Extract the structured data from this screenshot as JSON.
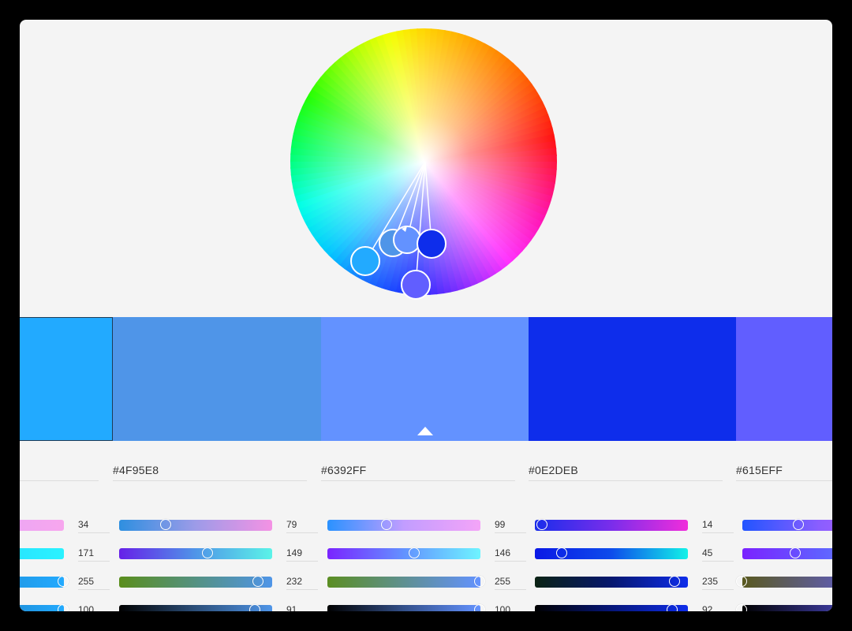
{
  "colors": {
    "panel_bg": "#f4f4f4",
    "swatch_border": "#1d3c57",
    "marker": "#ffffff"
  },
  "wheel": {
    "handles": [
      {
        "name": "handle-1",
        "color": "#22AAFF"
      },
      {
        "name": "handle-2",
        "color": "#4F95E8"
      },
      {
        "name": "handle-3",
        "color": "#6392FF"
      },
      {
        "name": "handle-4",
        "color": "#0E2DEB"
      },
      {
        "name": "handle-5",
        "color": "#615EFF"
      }
    ]
  },
  "swatches": [
    {
      "name": "swatch-1",
      "color": "#22AAFF",
      "selected": true,
      "marker": false
    },
    {
      "name": "swatch-2",
      "color": "#4F95E8",
      "selected": false,
      "marker": false
    },
    {
      "name": "swatch-3",
      "color": "#6392FF",
      "selected": false,
      "marker": true
    },
    {
      "name": "swatch-4",
      "color": "#0E2DEB",
      "selected": false,
      "marker": false
    },
    {
      "name": "swatch-5",
      "color": "#615EFF",
      "selected": false,
      "marker": false
    }
  ],
  "columns": [
    {
      "hex": "",
      "rows": [
        {
          "value": "34",
          "fraction": 0.12,
          "gradient": "linear-gradient(90deg,#d9a4ff,#f7a6ee)"
        },
        {
          "value": "171",
          "fraction": 0.67,
          "gradient": "linear-gradient(90deg,#24c9ff,#2af2ff)"
        },
        {
          "value": "255",
          "fraction": 1.0,
          "gradient": "linear-gradient(90deg,#1e7ab8,#22aaff)"
        },
        {
          "value": "100",
          "fraction": 1.0,
          "gradient": "linear-gradient(90deg,#1b5e93,#22aaff)"
        }
      ]
    },
    {
      "hex": "#4F95E8",
      "rows": [
        {
          "value": "79",
          "fraction": 0.31,
          "gradient": "linear-gradient(90deg,#2e8fe0,#9d9be8,#f492e4)"
        },
        {
          "value": "149",
          "fraction": 0.58,
          "gradient": "linear-gradient(90deg,#6620e8,#4f95e8,#5bf3e8)"
        },
        {
          "value": "232",
          "fraction": 0.91,
          "gradient": "linear-gradient(90deg,#5a8e1c,#4f95e8)"
        },
        {
          "value": "91",
          "fraction": 0.89,
          "gradient": "linear-gradient(90deg,#000000,#2c4f7a,#4f95e8)"
        }
      ]
    },
    {
      "hex": "#6392FF",
      "rows": [
        {
          "value": "99",
          "fraction": 0.39,
          "gradient": "linear-gradient(90deg,#2a92ff,#c29dff,#f4a4f8)"
        },
        {
          "value": "146",
          "fraction": 0.57,
          "gradient": "linear-gradient(90deg,#7a24ff,#6392ff,#6ef4ff)"
        },
        {
          "value": "255",
          "fraction": 1.0,
          "gradient": "linear-gradient(90deg,#5b8e22,#6392ff)"
        },
        {
          "value": "100",
          "fraction": 1.0,
          "gradient": "linear-gradient(90deg,#000000,#33508a,#6392ff)"
        }
      ]
    },
    {
      "hex": "#0E2DEB",
      "rows": [
        {
          "value": "14",
          "fraction": 0.05,
          "gradient": "linear-gradient(90deg,#1a2deb,#7a2deb,#f02ddb)"
        },
        {
          "value": "45",
          "fraction": 0.18,
          "gradient": "linear-gradient(90deg,#0a18e6,#0e4ceb,#12f2e8)"
        },
        {
          "value": "235",
          "fraction": 0.92,
          "gradient": "linear-gradient(90deg,#0b2314,#06176e,#0e2deb)"
        },
        {
          "value": "92",
          "fraction": 0.9,
          "gradient": "linear-gradient(90deg,#000000,#061679,#0e2deb)"
        }
      ]
    },
    {
      "hex": "#615EFF",
      "rows": [
        {
          "value": "",
          "fraction": 0.37,
          "gradient": "linear-gradient(90deg,#2255ff,#8a5eff,#c05eff)"
        },
        {
          "value": "",
          "fraction": 0.35,
          "gradient": "linear-gradient(90deg,#7b22ff,#615eff,#6196ff)"
        },
        {
          "value": "",
          "fraction": 0.0,
          "gradient": "linear-gradient(90deg,#5a5a1f,#615eff)"
        },
        {
          "value": "",
          "fraction": 0.0,
          "gradient": "linear-gradient(90deg,#000000,#615eff)"
        }
      ]
    }
  ]
}
